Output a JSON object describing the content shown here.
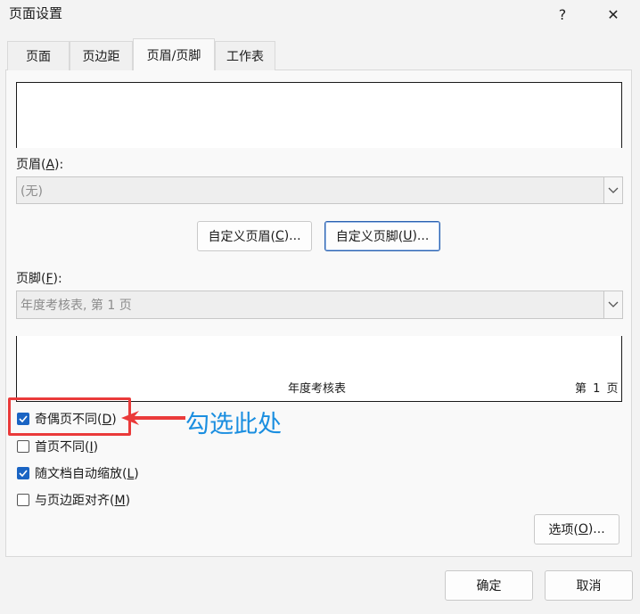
{
  "window": {
    "title": "页面设置",
    "help": "?",
    "close": "✕"
  },
  "tabs": [
    {
      "label": "页面"
    },
    {
      "label": "页边距"
    },
    {
      "label": "页眉/页脚"
    },
    {
      "label": "工作表"
    }
  ],
  "header": {
    "label": "页眉(",
    "accel": "A",
    "label_end": "):",
    "value": "(无)"
  },
  "custom_header_btn": {
    "label": "自定义页眉(",
    "accel": "C",
    "label_end": ")..."
  },
  "custom_footer_btn": {
    "label": "自定义页脚(",
    "accel": "U",
    "label_end": ")..."
  },
  "footer": {
    "label": "页脚(",
    "accel": "F",
    "label_end": "):",
    "value": "年度考核表, 第 1 页",
    "preview_center": "年度考核表",
    "preview_right": "第 1 页"
  },
  "checkboxes": [
    {
      "label": "奇偶页不同(",
      "accel": "D",
      "label_end": ")",
      "checked": true
    },
    {
      "label": "首页不同(",
      "accel": "I",
      "label_end": ")",
      "checked": false
    },
    {
      "label": "随文档自动缩放(",
      "accel": "L",
      "label_end": ")",
      "checked": true
    },
    {
      "label": "与页边距对齐(",
      "accel": "M",
      "label_end": ")",
      "checked": false
    }
  ],
  "annotation": {
    "text": "勾选此处",
    "color": "#1a8ee0",
    "box_color": "#ea3a3a"
  },
  "options_btn": {
    "label": "选项(",
    "accel": "O",
    "label_end": ")..."
  },
  "ok_btn": {
    "label": "确定"
  },
  "cancel_btn": {
    "label": "取消"
  }
}
